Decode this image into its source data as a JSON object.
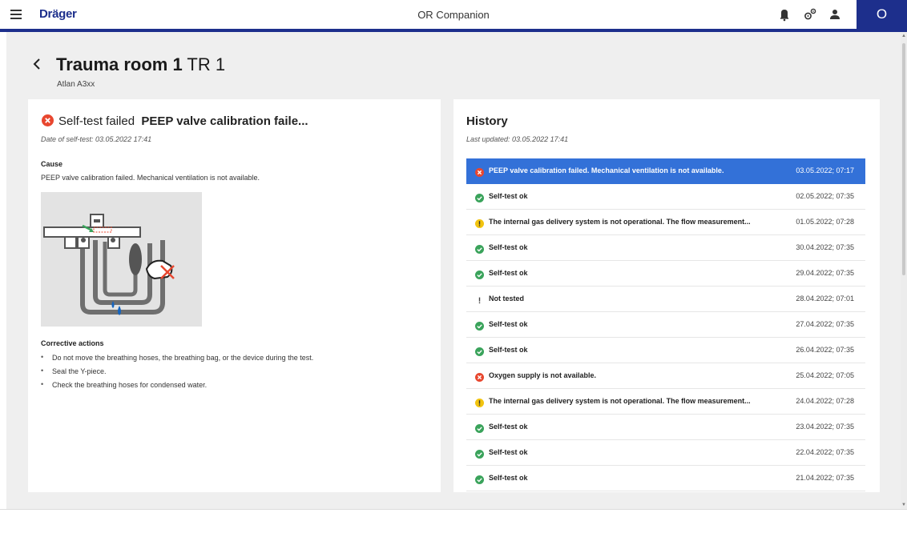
{
  "header": {
    "brand": "Dräger",
    "app_title": "OR Companion",
    "user_initial": "O",
    "icons": [
      "menu-icon",
      "bell-icon",
      "gears-icon",
      "user-icon"
    ]
  },
  "colors": {
    "brand_blue": "#1d2f8c",
    "selected_row": "#3371d8",
    "error_red": "#e8472f",
    "ok_green": "#3aa35b",
    "warning_yellow": "#f2c40f"
  },
  "page": {
    "title_bold": "Trauma room 1",
    "title_suffix": " TR 1",
    "device": "Atlan A3xx"
  },
  "selftest": {
    "status_prefix": "Self-test failed",
    "status_detail": "PEEP valve calibration faile...",
    "date_label": "Date of self-test: 03.05.2022 17:41",
    "cause_heading": "Cause",
    "cause_text": "PEEP valve calibration failed. Mechanical ventilation is not available.",
    "corrective_heading": "Corrective actions",
    "corrective_actions": [
      "Do not move the breathing hoses, the breathing bag, or the device during the test.",
      "Seal the Y-piece.",
      "Check the breathing hoses for condensed water."
    ]
  },
  "history": {
    "title": "History",
    "last_updated": "Last updated: 03.05.2022 17:41",
    "rows": [
      {
        "status": "error",
        "label": "PEEP valve calibration failed. Mechanical ventilation is not available.",
        "date": "03.05.2022; 07:17",
        "selected": true
      },
      {
        "status": "ok",
        "label": "Self-test ok",
        "date": "02.05.2022; 07:35"
      },
      {
        "status": "warning",
        "label": "The internal gas delivery system is not operational. The flow measurement...",
        "date": "01.05.2022; 07:28"
      },
      {
        "status": "ok",
        "label": "Self-test ok",
        "date": "30.04.2022; 07:35"
      },
      {
        "status": "ok",
        "label": "Self-test ok",
        "date": "29.04.2022; 07:35"
      },
      {
        "status": "not-tested",
        "label": "Not tested",
        "date": "28.04.2022; 07:01"
      },
      {
        "status": "ok",
        "label": "Self-test ok",
        "date": "27.04.2022; 07:35"
      },
      {
        "status": "ok",
        "label": "Self-test ok",
        "date": "26.04.2022; 07:35"
      },
      {
        "status": "error",
        "label": "Oxygen supply is not available.",
        "date": "25.04.2022; 07:05"
      },
      {
        "status": "warning",
        "label": "The internal gas delivery system is not operational. The flow measurement...",
        "date": "24.04.2022; 07:28"
      },
      {
        "status": "ok",
        "label": "Self-test ok",
        "date": "23.04.2022; 07:35"
      },
      {
        "status": "ok",
        "label": "Self-test ok",
        "date": "22.04.2022; 07:35"
      },
      {
        "status": "ok",
        "label": "Self-test ok",
        "date": "21.04.2022; 07:35"
      }
    ]
  }
}
